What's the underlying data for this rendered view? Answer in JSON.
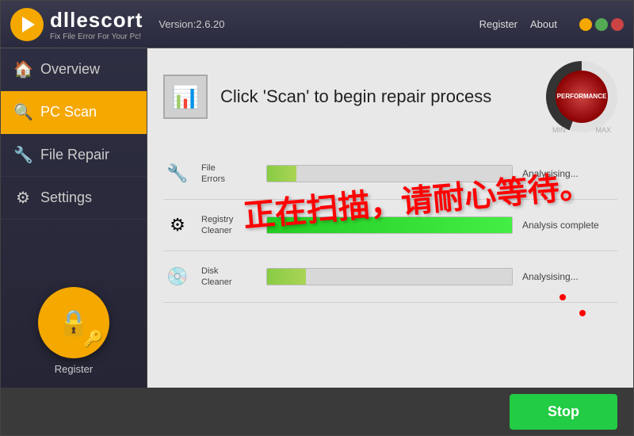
{
  "app": {
    "name": "dllescort",
    "tagline": "Fix File Error For Your Pc!",
    "version": "Version:2.6.20"
  },
  "header": {
    "register_label": "Register",
    "about_label": "About"
  },
  "sidebar": {
    "items": [
      {
        "id": "overview",
        "label": "Overview",
        "icon": "🏠",
        "active": false
      },
      {
        "id": "pc-scan",
        "label": "PC Scan",
        "icon": "🔍",
        "active": true
      },
      {
        "id": "file-repair",
        "label": "File Repair",
        "icon": "🔧",
        "active": false
      },
      {
        "id": "settings",
        "label": "Settings",
        "icon": "⚙",
        "active": false
      }
    ],
    "register_label": "Register"
  },
  "content": {
    "title": "Click 'Scan' to begin repair process",
    "gauge": {
      "top_label": "PERFORMANCE",
      "min_label": "MIN",
      "max_label": "MAX"
    },
    "progress_items": [
      {
        "id": "file-errors",
        "label": "File\nErrors",
        "icon": "🔧",
        "percent": 12,
        "bar_type": "partial",
        "status": "Analysising..."
      },
      {
        "id": "registry-cleaner",
        "label": "Registry\nCleaner",
        "icon": "⚙",
        "percent": 100,
        "bar_type": "complete",
        "status": "Analysis complete"
      },
      {
        "id": "disk-cleaner",
        "label": "Disk\nCleaner",
        "icon": "💿",
        "percent": 16,
        "bar_type": "partial",
        "status": "Analysising..."
      }
    ],
    "watermark": "正在扫描，请耐心等待。"
  },
  "footer": {
    "stop_label": "Stop"
  }
}
